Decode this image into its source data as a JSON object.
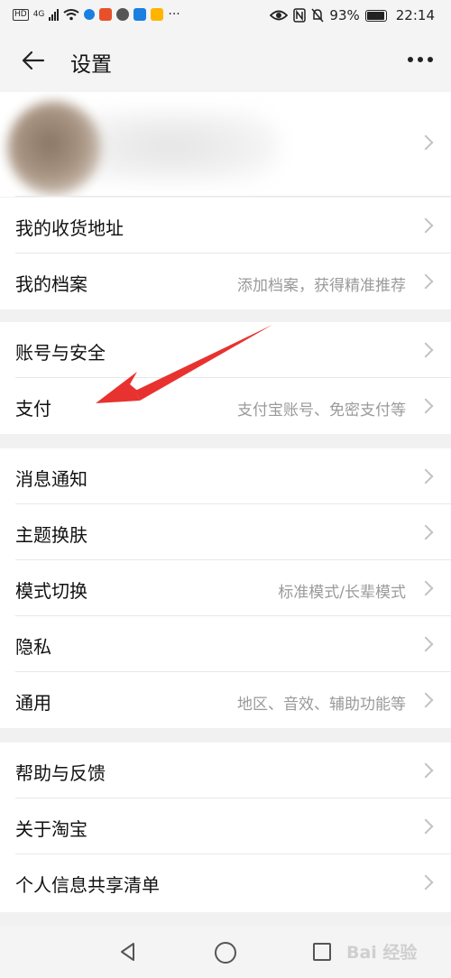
{
  "status_bar": {
    "net_label": "HD",
    "net_type": "4G",
    "battery": "93%",
    "time": "22:14",
    "app_icon_colors": [
      "#e8502a",
      "#555555",
      "#1a7fe0",
      "#ffb400"
    ]
  },
  "header": {
    "title": "设置"
  },
  "sections": [
    {
      "items": [
        {
          "label": "我的收货地址",
          "hint": ""
        },
        {
          "label": "我的档案",
          "hint": "添加档案，获得精准推荐"
        }
      ]
    },
    {
      "items": [
        {
          "label": "账号与安全",
          "hint": ""
        },
        {
          "label": "支付",
          "hint": "支付宝账号、免密支付等"
        }
      ]
    },
    {
      "items": [
        {
          "label": "消息通知",
          "hint": ""
        },
        {
          "label": "主题换肤",
          "hint": ""
        },
        {
          "label": "模式切换",
          "hint": "标准模式/长辈模式"
        },
        {
          "label": "隐私",
          "hint": ""
        },
        {
          "label": "通用",
          "hint": "地区、音效、辅助功能等"
        }
      ]
    },
    {
      "items": [
        {
          "label": "帮助与反馈",
          "hint": ""
        },
        {
          "label": "关于淘宝",
          "hint": ""
        },
        {
          "label": "个人信息共享清单",
          "hint": ""
        }
      ]
    }
  ],
  "watermark": "Bai 经验",
  "colors": {
    "annotation_arrow": "#e8322f",
    "hint_text": "#9a9a9a",
    "background": "#f1f1f1"
  }
}
